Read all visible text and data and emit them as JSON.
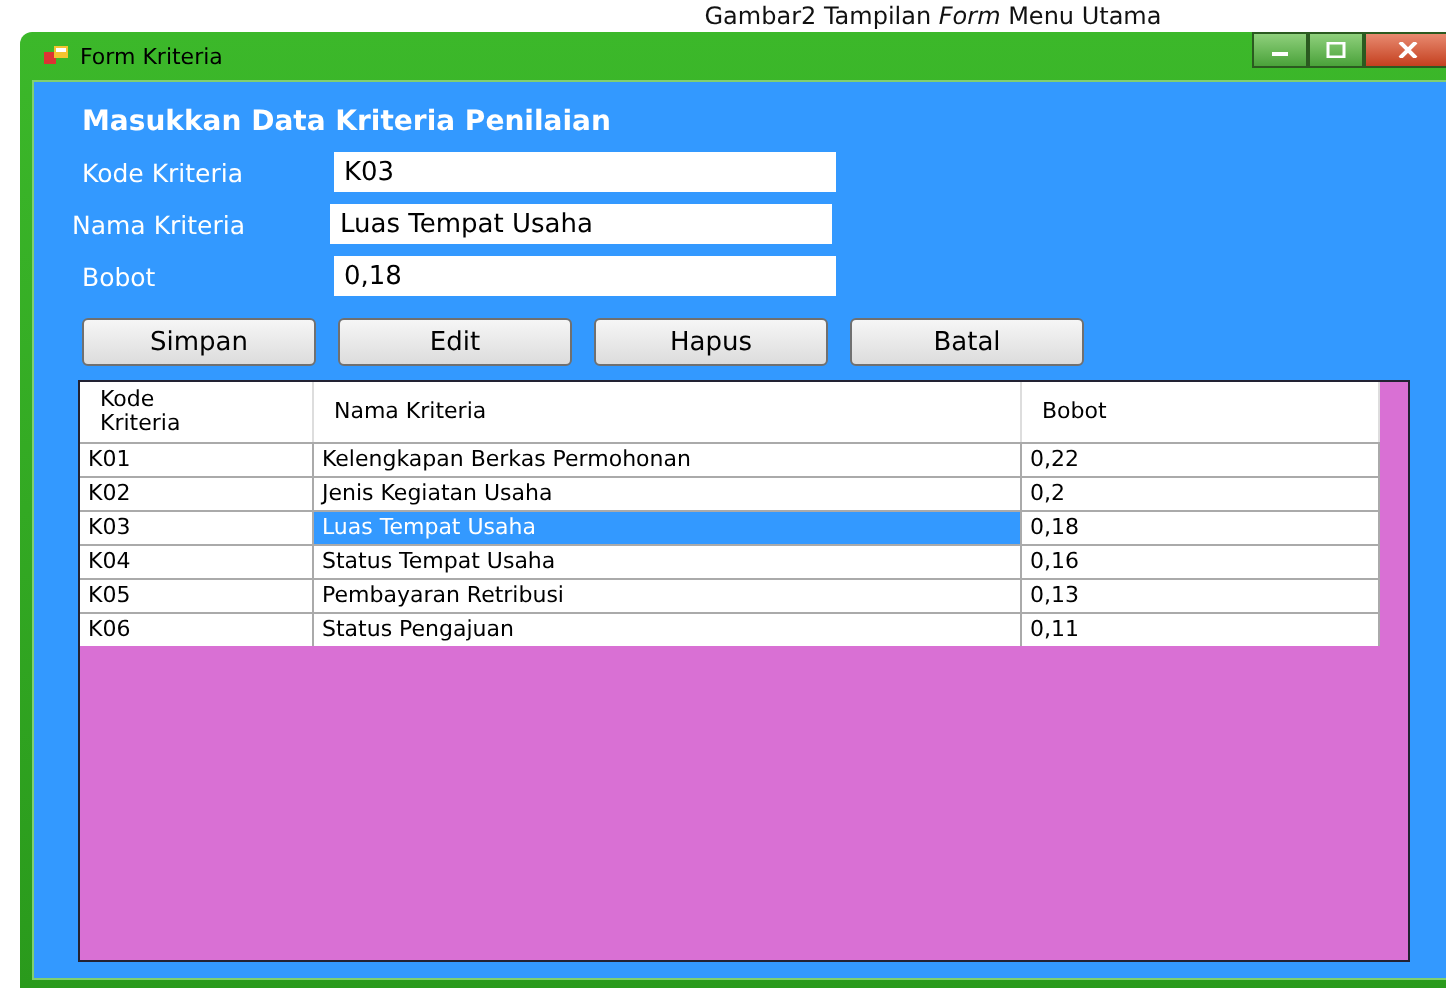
{
  "caption": "Gambar2 Tampilan *Form* Menu Utama",
  "window": {
    "title": "Form Kriteria"
  },
  "heading": "Masukkan Data Kriteria Penilaian",
  "fields": [
    {
      "label": "Kode Kriteria",
      "value": "K03"
    },
    {
      "label": "Nama Kriteria",
      "value": "Luas Tempat Usaha"
    },
    {
      "label": "Bobot",
      "value": "0,18"
    }
  ],
  "buttons": [
    "Simpan",
    "Edit",
    "Hapus",
    "Batal"
  ],
  "table": {
    "columns": [
      "Kode\nKriteria",
      "Nama Kriteria",
      "Bobot"
    ],
    "rows": [
      {
        "cells": [
          "K01",
          "Kelengkapan Berkas Permohonan",
          "0,22"
        ],
        "selected": false
      },
      {
        "cells": [
          "K02",
          "Jenis Kegiatan Usaha",
          "0,2"
        ],
        "selected": false
      },
      {
        "cells": [
          "K03",
          "Luas Tempat Usaha",
          "0,18"
        ],
        "selected": true
      },
      {
        "cells": [
          "K04",
          "Status Tempat Usaha",
          "0,16"
        ],
        "selected": false
      },
      {
        "cells": [
          "K05",
          "Pembayaran Retribusi",
          "0,13"
        ],
        "selected": false
      },
      {
        "cells": [
          "K06",
          "Status Pengajuan",
          "0,11"
        ],
        "selected": false
      }
    ]
  }
}
